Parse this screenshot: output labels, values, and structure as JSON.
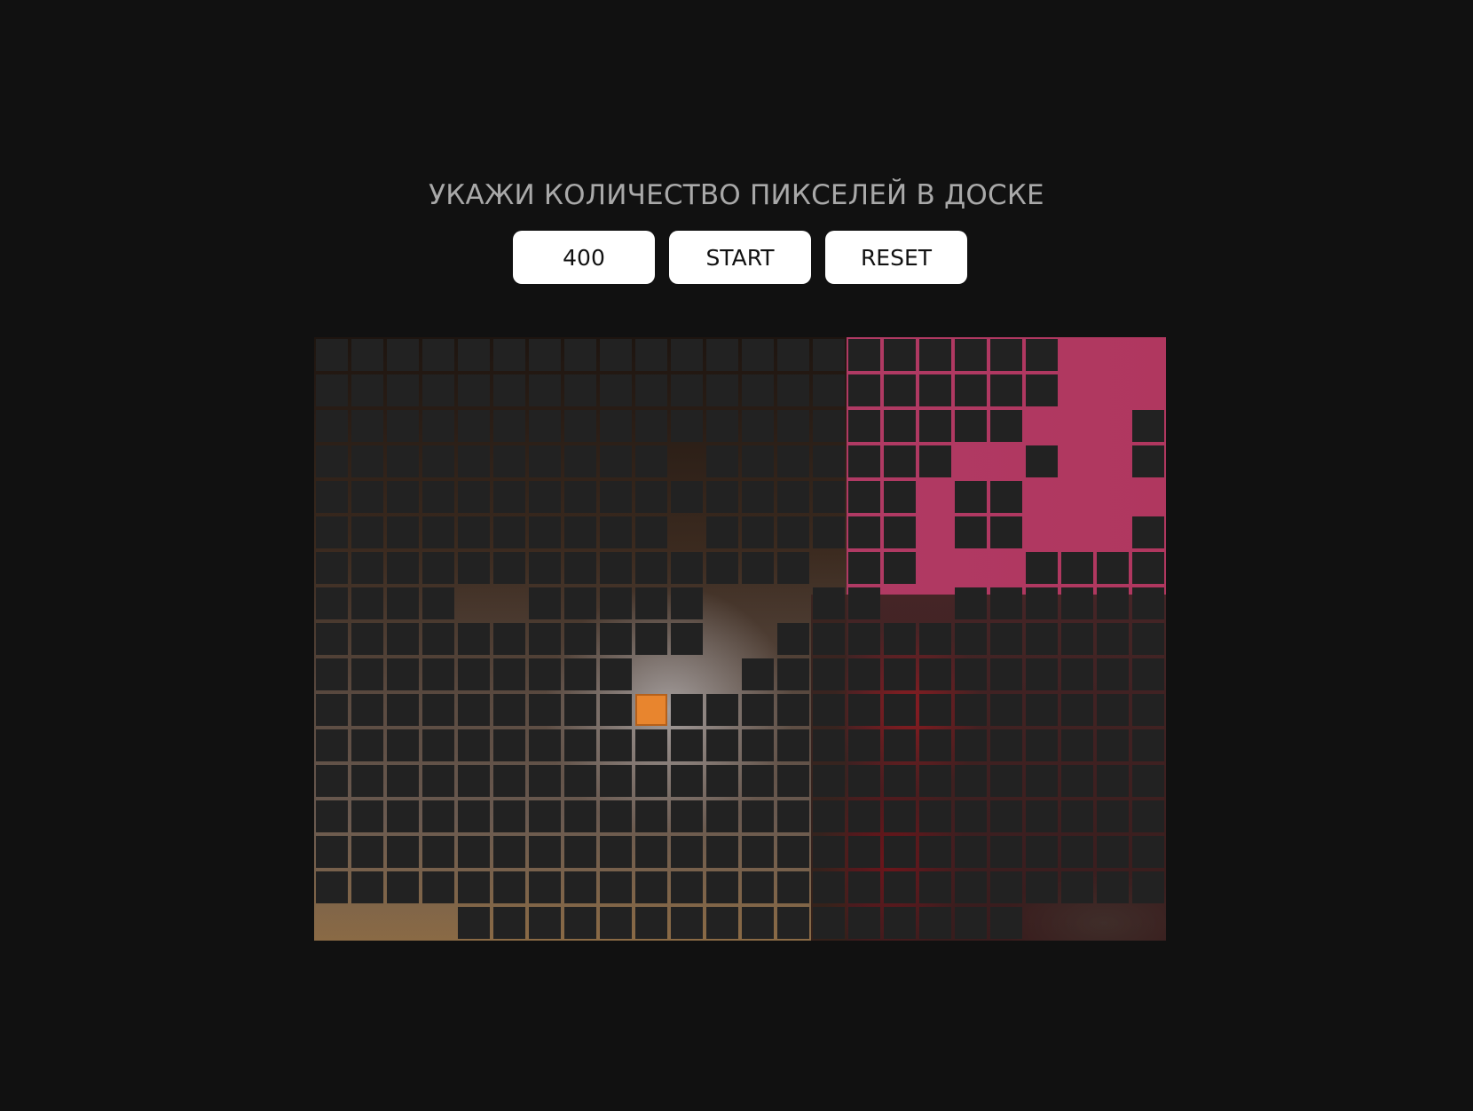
{
  "header": {
    "title": "УКАЖИ КОЛИЧЕСТВО ПИКСЕЛЕЙ В ДОСКЕ"
  },
  "controls": {
    "pixel_count_value": "400",
    "start_label": "START",
    "reset_label": "RESET"
  },
  "board": {
    "cols": 24,
    "rows": 17,
    "tile_color": "#222222",
    "player_color": "#e8852e",
    "background_color": "#111111",
    "player": {
      "row": 10,
      "col": 9
    },
    "open_cells": [
      [
        0,
        21
      ],
      [
        0,
        22
      ],
      [
        0,
        23
      ],
      [
        1,
        21
      ],
      [
        1,
        22
      ],
      [
        1,
        23
      ],
      [
        2,
        20
      ],
      [
        2,
        21
      ],
      [
        2,
        22
      ],
      [
        3,
        10
      ],
      [
        3,
        18
      ],
      [
        3,
        19
      ],
      [
        3,
        21
      ],
      [
        3,
        22
      ],
      [
        4,
        17
      ],
      [
        4,
        20
      ],
      [
        4,
        21
      ],
      [
        4,
        22
      ],
      [
        4,
        23
      ],
      [
        5,
        10
      ],
      [
        5,
        17
      ],
      [
        5,
        20
      ],
      [
        5,
        21
      ],
      [
        5,
        22
      ],
      [
        6,
        14
      ],
      [
        6,
        17
      ],
      [
        6,
        18
      ],
      [
        6,
        19
      ],
      [
        7,
        4
      ],
      [
        7,
        5
      ],
      [
        7,
        11
      ],
      [
        7,
        12
      ],
      [
        7,
        13
      ],
      [
        7,
        16
      ],
      [
        7,
        17
      ],
      [
        8,
        11
      ],
      [
        8,
        12
      ],
      [
        9,
        9
      ],
      [
        9,
        10
      ],
      [
        9,
        11
      ],
      [
        16,
        0
      ],
      [
        16,
        1
      ],
      [
        16,
        2
      ],
      [
        16,
        3
      ],
      [
        16,
        20
      ],
      [
        16,
        21
      ],
      [
        16,
        22
      ],
      [
        16,
        23
      ]
    ]
  }
}
